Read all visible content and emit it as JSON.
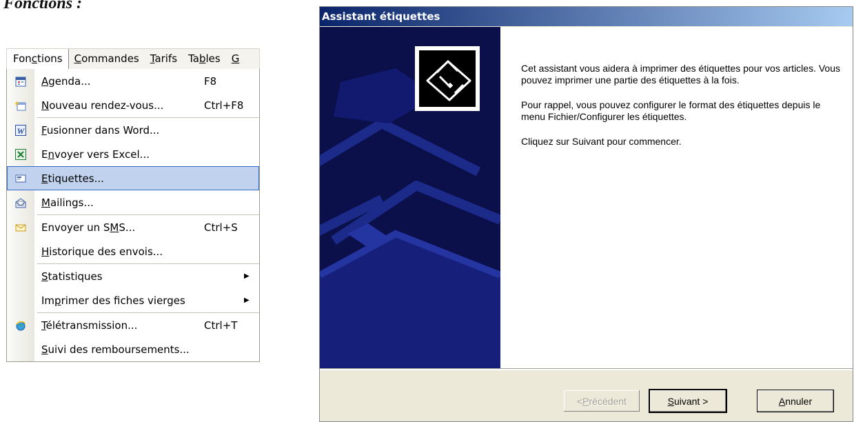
{
  "heading": "Fonctions :",
  "menubar": {
    "items": [
      {
        "pre": "Fon",
        "u": "c",
        "post": "tions"
      },
      {
        "pre": "",
        "u": "C",
        "post": "ommandes"
      },
      {
        "pre": "",
        "u": "T",
        "post": "arifs"
      },
      {
        "pre": "Ta",
        "u": "b",
        "post": "les"
      },
      {
        "pre": "",
        "u": "G",
        "post": ""
      }
    ]
  },
  "menu": {
    "agenda": {
      "u": "A",
      "rest": "genda...",
      "shortcut": "F8"
    },
    "rdv": {
      "u": "N",
      "rest": "ouveau rendez-vous...",
      "shortcut": "Ctrl+F8"
    },
    "word": {
      "u": "F",
      "rest": "usionner dans Word..."
    },
    "excel": {
      "pre": "E",
      "u": "n",
      "rest": "voyer vers Excel..."
    },
    "etiquettes": {
      "u": "E",
      "rest": "tiquettes..."
    },
    "mailings": {
      "u": "M",
      "rest": "ailings..."
    },
    "sms": {
      "pre": "Envoyer un S",
      "u": "M",
      "rest": "S...",
      "shortcut": "Ctrl+S"
    },
    "historique": {
      "u": "H",
      "rest": "istorique des envois..."
    },
    "statistiques": {
      "u": "S",
      "rest": "tatistiques"
    },
    "fiches": {
      "pre": "Im",
      "u": "p",
      "rest": "rimer des fiches vierges"
    },
    "teletrans": {
      "u": "T",
      "rest": "élétransmission...",
      "shortcut": "Ctrl+T"
    },
    "suivi": {
      "u": "S",
      "rest": "uivi des remboursements..."
    }
  },
  "dialog": {
    "title": "Assistant étiquettes",
    "p1": "Cet assistant vous aidera à imprimer des étiquettes pour vos articles. Vous pouvez imprimer une partie des étiquettes à la fois.",
    "p2": "Pour rappel, vous pouvez configurer le format des étiquettes depuis le menu Fichier/Configurer les étiquettes.",
    "p3": "Cliquez sur Suivant pour commencer.",
    "btn_prev": {
      "pre": "< ",
      "u": "P",
      "rest": "récédent"
    },
    "btn_next": {
      "pre": "",
      "u": "S",
      "rest": "uivant >"
    },
    "btn_cancel": {
      "pre": "",
      "u": "A",
      "rest": "nnuler"
    }
  },
  "colors": {
    "highlight": "#c1d2ee",
    "titlebar": "#0a246a",
    "side_panel": "#0b0f4a"
  }
}
